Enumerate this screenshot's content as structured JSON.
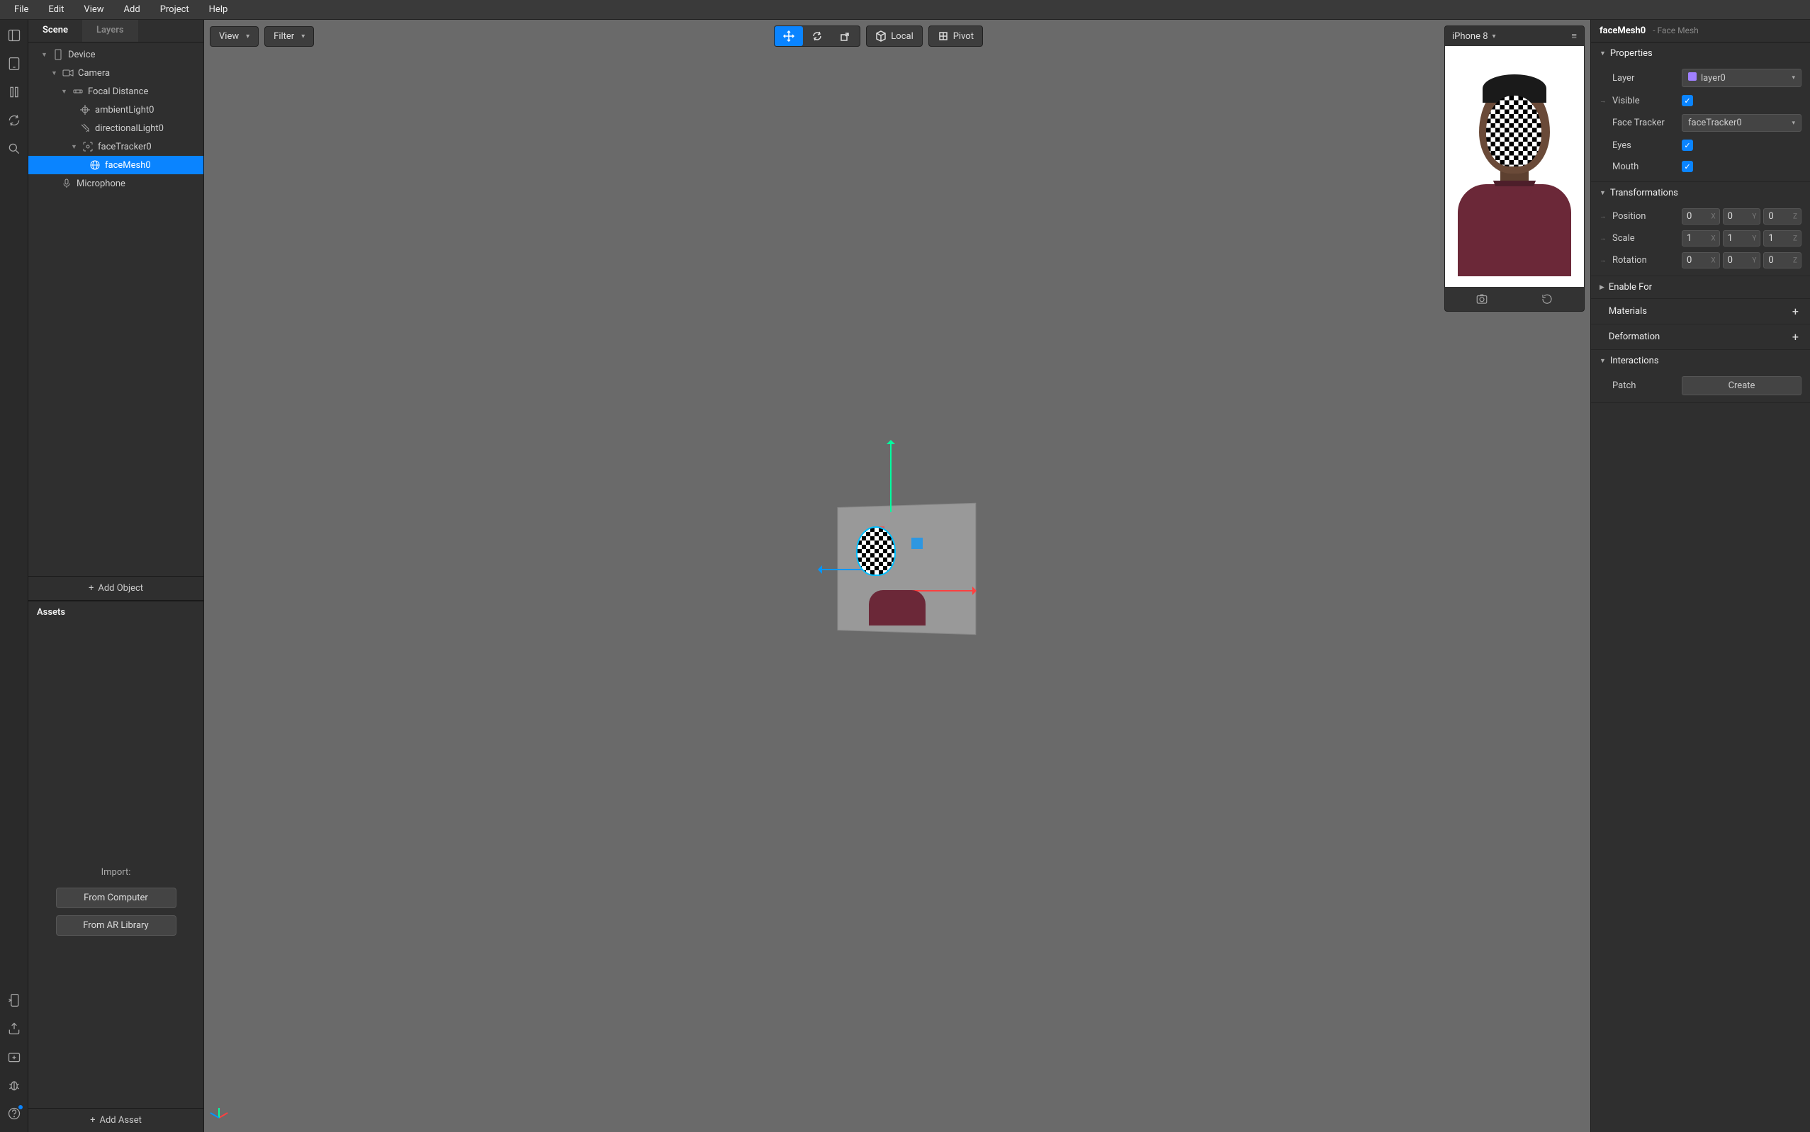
{
  "menubar": [
    "File",
    "Edit",
    "View",
    "Add",
    "Project",
    "Help"
  ],
  "scenePanel": {
    "tabs": {
      "scene": "Scene",
      "layers": "Layers"
    },
    "tree": {
      "device": "Device",
      "camera": "Camera",
      "focal": "Focal Distance",
      "ambient": "ambientLight0",
      "directional": "directionalLight0",
      "faceTracker": "faceTracker0",
      "faceMesh": "faceMesh0",
      "microphone": "Microphone"
    },
    "addObject": "Add Object"
  },
  "assets": {
    "title": "Assets",
    "import": "Import:",
    "fromComputer": "From Computer",
    "fromARLibrary": "From AR Library",
    "addAsset": "Add Asset"
  },
  "viewportToolbar": {
    "view": "View",
    "filter": "Filter",
    "local": "Local",
    "pivot": "Pivot"
  },
  "devicePreview": {
    "name": "iPhone 8"
  },
  "inspector": {
    "title": "faceMesh0",
    "subtitle": "- Face Mesh",
    "sections": {
      "properties": "Properties",
      "transformations": "Transformations",
      "enableFor": "Enable For",
      "materials": "Materials",
      "deformation": "Deformation",
      "interactions": "Interactions"
    },
    "props": {
      "layer": {
        "label": "Layer",
        "value": "layer0"
      },
      "visible": {
        "label": "Visible",
        "checked": true
      },
      "faceTracker": {
        "label": "Face Tracker",
        "value": "faceTracker0"
      },
      "eyes": {
        "label": "Eyes",
        "checked": true
      },
      "mouth": {
        "label": "Mouth",
        "checked": true
      }
    },
    "transform": {
      "position": {
        "label": "Position",
        "x": "0",
        "y": "0",
        "z": "0"
      },
      "scale": {
        "label": "Scale",
        "x": "1",
        "y": "1",
        "z": "1"
      },
      "rotation": {
        "label": "Rotation",
        "x": "0",
        "y": "0",
        "z": "0"
      }
    },
    "patch": {
      "label": "Patch",
      "create": "Create"
    }
  }
}
